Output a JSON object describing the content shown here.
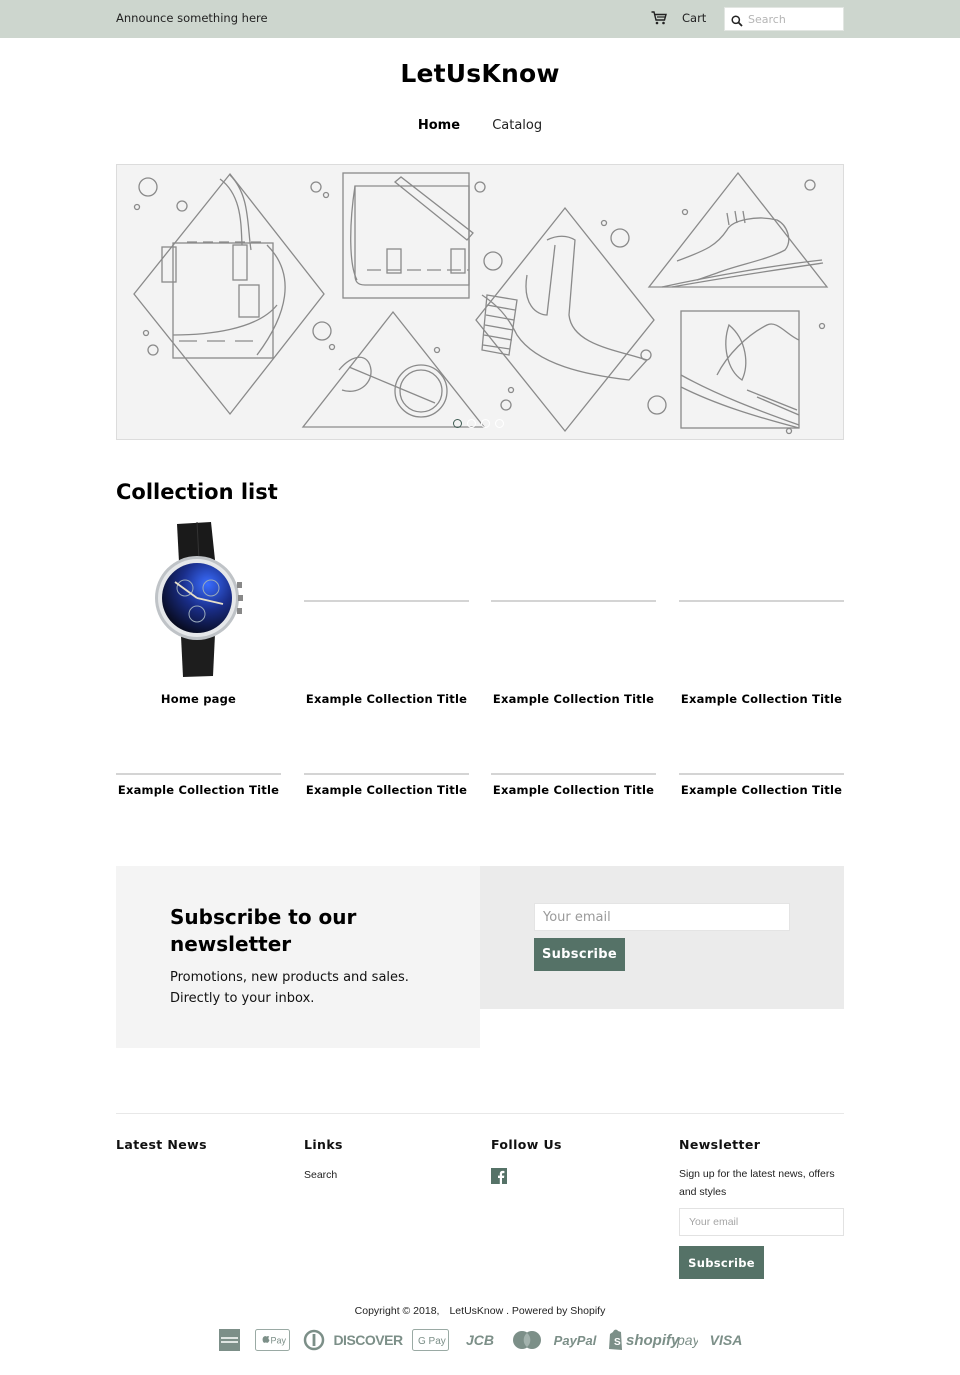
{
  "announcement": {
    "text": "Announce something here"
  },
  "topbar": {
    "cart_label": "Cart",
    "search_placeholder": "Search"
  },
  "header": {
    "site_title": "LetUsKnow",
    "nav": [
      {
        "label": "Home",
        "active": true
      },
      {
        "label": "Catalog",
        "active": false
      }
    ]
  },
  "slideshow": {
    "illustration": "line-art accessories: handbag, satchel, glasses, ankle boot, oxford shoe, feathered hat",
    "slide_count": 4,
    "active_slide": 1
  },
  "collection_list": {
    "title": "Collection list",
    "items": [
      {
        "title": "Home page",
        "image": "wristwatch-image"
      },
      {
        "title": "Example Collection Title",
        "image": "placeholder"
      },
      {
        "title": "Example Collection Title",
        "image": "placeholder"
      },
      {
        "title": "Example Collection Title",
        "image": "placeholder"
      },
      {
        "title": "Example Collection Title",
        "image": "placeholder"
      },
      {
        "title": "Example Collection Title",
        "image": "placeholder"
      },
      {
        "title": "Example Collection Title",
        "image": "placeholder"
      },
      {
        "title": "Example Collection Title",
        "image": "placeholder"
      }
    ]
  },
  "newsletter_band": {
    "heading": "Subscribe to our newsletter",
    "text_line1": "Promotions, new products and sales.",
    "text_line2": "Directly to your inbox.",
    "email_placeholder": "Your email",
    "button_label": "Subscribe"
  },
  "footer": {
    "latest_news": {
      "heading": "Latest News"
    },
    "links": {
      "heading": "Links",
      "items": [
        "Search"
      ]
    },
    "follow_us": {
      "heading": "Follow Us",
      "icons": [
        "facebook-icon"
      ]
    },
    "newsletter": {
      "heading": "Newsletter",
      "text": "Sign up for the latest news, offers and styles",
      "email_placeholder": "Your email",
      "button_label": "Subscribe"
    },
    "copyright": "Copyright © 2018,",
    "copyright_store": "LetUsKnow",
    "powered_by": ". Powered by Shopify",
    "payment_icons": [
      "American Express",
      "Apple Pay",
      "Diners Club",
      "DISCOVER",
      "G Pay",
      "JCB",
      "MasterCard",
      "PayPal",
      "shopify pay",
      "VISA"
    ]
  },
  "colors": {
    "announcement_bg": "#cdd6ce",
    "accent": "#557267",
    "band_left_bg": "#f4f4f4",
    "band_right_bg": "#ebebeb",
    "payment_icon": "#7c8f88"
  }
}
